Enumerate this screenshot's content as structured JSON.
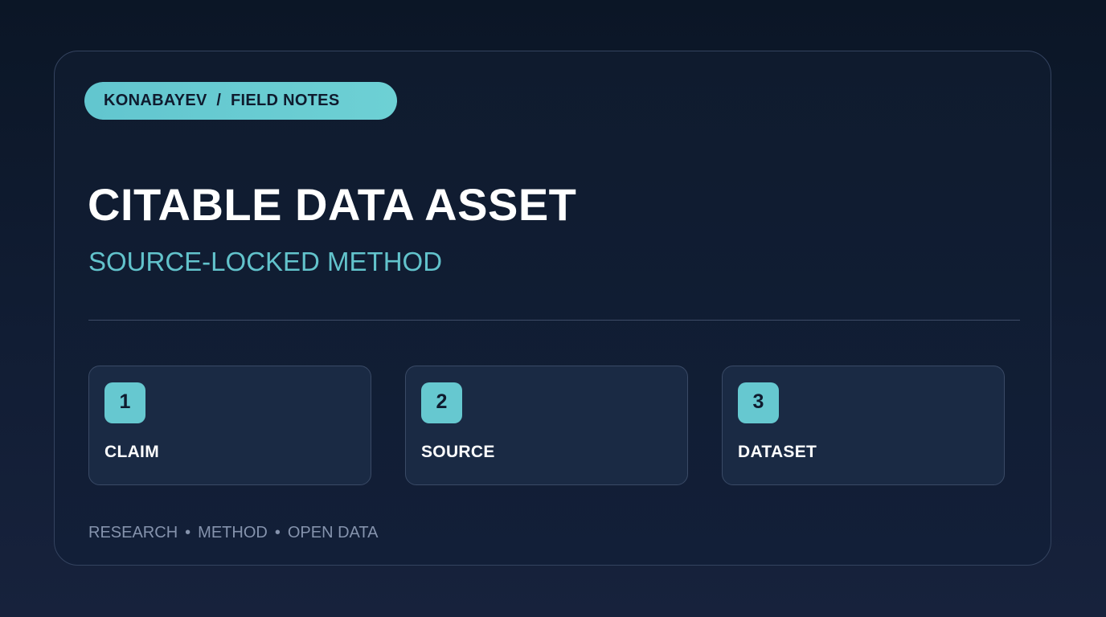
{
  "header": {
    "tag_label": "KONABAYEV  /  FIELD NOTES"
  },
  "hero": {
    "title": "CITABLE DATA ASSET",
    "subtitle": "SOURCE-LOCKED METHOD"
  },
  "steps": [
    {
      "number": "1",
      "label": "CLAIM"
    },
    {
      "number": "2",
      "label": "SOURCE"
    },
    {
      "number": "3",
      "label": "DATASET"
    }
  ],
  "footer": {
    "tags": [
      "RESEARCH",
      "METHOD",
      "OPEN DATA"
    ],
    "separator": "•"
  },
  "colors": {
    "accent": "#66c8d0",
    "background": "#0f1b2e",
    "card_border": "#34435f",
    "step_bg": "#1a2a44",
    "muted_text": "#8593ad"
  }
}
